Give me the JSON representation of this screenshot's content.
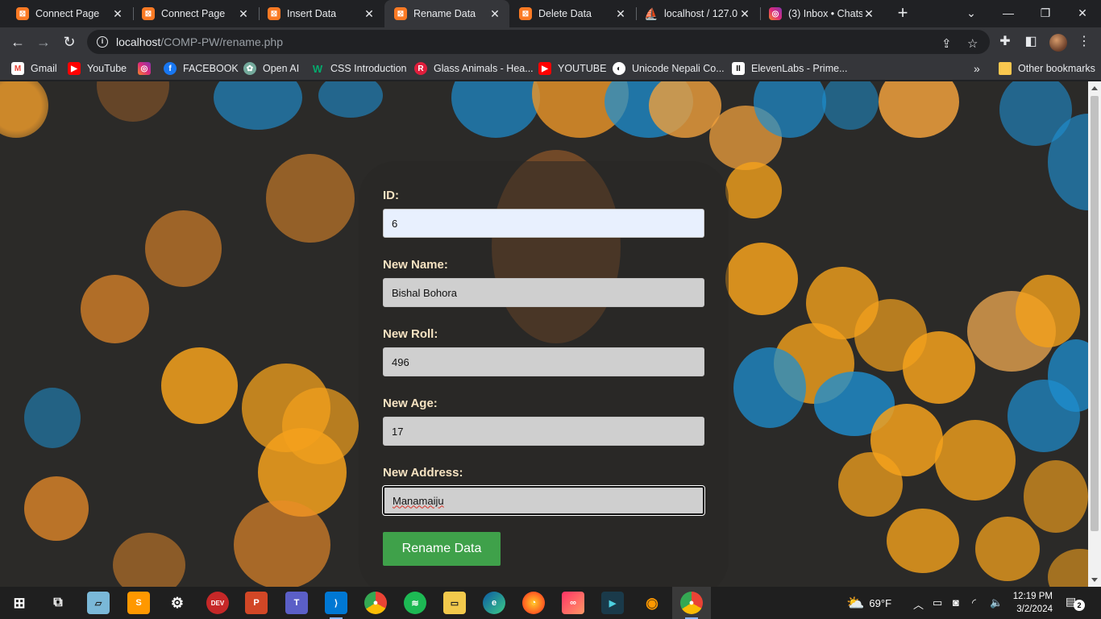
{
  "browser": {
    "tabs": [
      {
        "title": "Connect Page",
        "icon": "xampp-icon",
        "active": false
      },
      {
        "title": "Connect Page",
        "icon": "xampp-icon",
        "active": false
      },
      {
        "title": "Insert Data",
        "icon": "xampp-icon",
        "active": false
      },
      {
        "title": "Rename Data",
        "icon": "xampp-icon",
        "active": true
      },
      {
        "title": "Delete Data",
        "icon": "xampp-icon",
        "active": false
      },
      {
        "title": "localhost / 127.0.",
        "icon": "phpmyadmin-icon",
        "active": false
      },
      {
        "title": "(3) Inbox • Chats",
        "icon": "instagram-icon",
        "active": false
      }
    ],
    "url_host": "localhost",
    "url_path": "/COMP-PW/rename.php",
    "bookmarks": [
      {
        "label": "Gmail",
        "icon": "gmail-icon",
        "color": "#ea4335"
      },
      {
        "label": "YouTube",
        "icon": "youtube-icon",
        "color": "#ff0000"
      },
      {
        "label": "",
        "icon": "instagram-icon",
        "color": "#dd2a7b"
      },
      {
        "label": "FACEBOOK",
        "icon": "facebook-icon",
        "color": "#1877f2"
      },
      {
        "label": "Open AI",
        "icon": "openai-icon",
        "color": "#74aa9c"
      },
      {
        "label": "CSS Introduction",
        "icon": "w3schools-icon",
        "color": "#04aa6d"
      },
      {
        "label": "Glass Animals - Hea...",
        "icon": "rdio-icon",
        "color": "#e01e3c"
      },
      {
        "label": "YOUTUBE",
        "icon": "youtube-icon",
        "color": "#ff0000"
      },
      {
        "label": "Unicode Nepali Co...",
        "icon": "globe-icon",
        "color": "#ffffff"
      },
      {
        "label": "ElevenLabs - Prime...",
        "icon": "elevenlabs-icon",
        "color": "#ffffff"
      }
    ],
    "other_bookmarks": "Other bookmarks",
    "overflow": "»"
  },
  "form": {
    "id_label": "ID:",
    "id_value": "6",
    "name_label": "New Name:",
    "name_value": "Bishal Bohora",
    "roll_label": "New Roll:",
    "roll_value": "496",
    "age_label": "New Age:",
    "age_value": "17",
    "address_label": "New Address:",
    "address_value": "Manamaiju",
    "submit_label": "Rename Data"
  },
  "taskbar": {
    "weather": "69°F",
    "time": "12:19 PM",
    "date": "3/2/2024",
    "notification_count": "2"
  },
  "colors": {
    "button_green": "#3fa14a",
    "label_cream": "#f6e3c2",
    "bokeh_orange": "#f4a11c",
    "bokeh_blue": "#1e8fd0"
  }
}
